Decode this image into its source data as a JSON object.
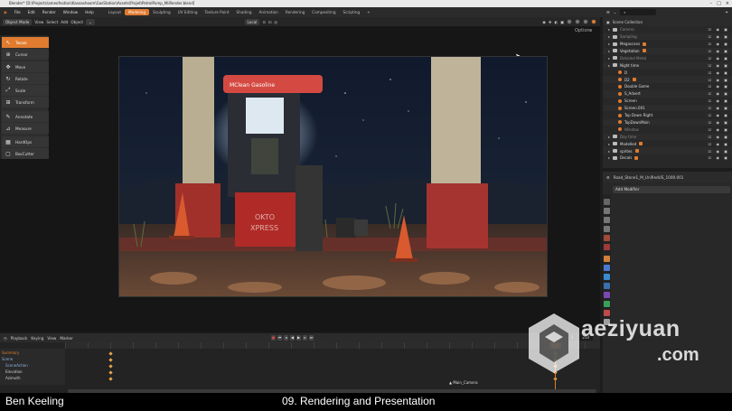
{
  "window": {
    "title": "Blender* [D:\\Projects\\ameofnotion\\Kasoashoom\\GasStation\\Assets\\Projet\\PetrolPump_MiiRender.blend]"
  },
  "menu": [
    "File",
    "Edit",
    "Render",
    "Window",
    "Help"
  ],
  "workspaces": [
    "Layout",
    "Modeling",
    "Sculpting",
    "UV Editing",
    "Texture Paint",
    "Shading",
    "Animation",
    "Rendering",
    "Compositing",
    "Scripting",
    "+"
  ],
  "active_workspace": "Modeling",
  "scene": {
    "label": "Scene",
    "view_layer": "View Layer"
  },
  "viewport_header": {
    "mode": "Object Mode",
    "menus": [
      "View",
      "Select",
      "Add",
      "Object"
    ],
    "orientation": "Local",
    "options": "Options"
  },
  "tools": [
    {
      "label": "Tweak",
      "icon": "cursor-arrow-icon",
      "active": true
    },
    {
      "label": "Cursor",
      "icon": "3d-cursor-icon"
    },
    {
      "label": "Move",
      "icon": "move-icon"
    },
    {
      "label": "Rotate",
      "icon": "rotate-icon"
    },
    {
      "label": "Scale",
      "icon": "scale-icon"
    },
    {
      "label": "Transform",
      "icon": "transform-icon"
    },
    {
      "label": "Annotate",
      "icon": "annotate-icon"
    },
    {
      "label": "Measure",
      "icon": "measure-icon"
    },
    {
      "label": "HardOps",
      "icon": "hardops-icon"
    },
    {
      "label": "BoxCutter",
      "icon": "boxcutter-icon"
    }
  ],
  "scene_text": {
    "pump_sign": "MClean Gasoline",
    "pump_brand": "OKTO",
    "pump_brand2": "XPRESS"
  },
  "outliner": {
    "title": "Scene Collection",
    "rows": [
      {
        "name": "Camera",
        "dim": true,
        "kind": "coll",
        "indent": 1
      },
      {
        "name": "Sampling",
        "dim": true,
        "kind": "coll",
        "indent": 1
      },
      {
        "name": "Megascans",
        "kind": "coll",
        "indent": 1,
        "badge": true
      },
      {
        "name": "Vegetation",
        "kind": "coll",
        "indent": 1,
        "badge": true
      },
      {
        "name": "Detailed Metal",
        "dim": true,
        "kind": "coll",
        "indent": 1
      },
      {
        "name": "Night time",
        "kind": "coll",
        "indent": 1
      },
      {
        "name": "D",
        "kind": "obj",
        "indent": 2
      },
      {
        "name": "D2",
        "kind": "obj",
        "indent": 2,
        "badge": true
      },
      {
        "name": "Double Game",
        "kind": "obj",
        "indent": 2
      },
      {
        "name": "S_Advert",
        "kind": "obj",
        "indent": 2
      },
      {
        "name": "Screen",
        "kind": "obj",
        "indent": 2
      },
      {
        "name": "Screen.001",
        "kind": "obj",
        "indent": 2
      },
      {
        "name": "Top Down Right",
        "kind": "obj",
        "indent": 2
      },
      {
        "name": "TopDownMain",
        "kind": "obj",
        "indent": 2
      },
      {
        "name": "Window",
        "dim": true,
        "kind": "obj",
        "indent": 2
      },
      {
        "name": "Day time",
        "dim": true,
        "kind": "coll",
        "indent": 1
      },
      {
        "name": "Modelled",
        "kind": "coll",
        "indent": 1,
        "badge": true
      },
      {
        "name": "sprites",
        "kind": "coll",
        "indent": 1,
        "badge": true
      },
      {
        "name": "Decals",
        "kind": "coll",
        "indent": 1,
        "badge": true
      }
    ]
  },
  "properties": {
    "object_name": "Road_Stone1_M_UnifiedUS_1000.001",
    "add_modifier": "Add Modifier"
  },
  "timeline": {
    "menus": [
      "Playback",
      "Keying",
      "View",
      "Marker"
    ],
    "start": "1",
    "end": "250",
    "current_frame": "210",
    "channels": [
      {
        "name": "Summary",
        "color": "#e07b2f"
      },
      {
        "name": "Scene",
        "color": "#8fb3e0"
      },
      {
        "name": "SceneAction",
        "color": "#8fb3e0"
      },
      {
        "name": "Elevation",
        "color": "#ccc"
      },
      {
        "name": "Azimuth",
        "color": "#ccc"
      }
    ],
    "marker": "Main_Camera"
  },
  "caption": {
    "author": "Ben Keeling",
    "lesson": "09. Rendering and Presentation"
  },
  "watermark": {
    "text": "aeziyuan",
    "tld": ".com"
  },
  "colors": {
    "accent": "#e07b2f",
    "panel": "#282828",
    "header": "#2b2b2b"
  }
}
